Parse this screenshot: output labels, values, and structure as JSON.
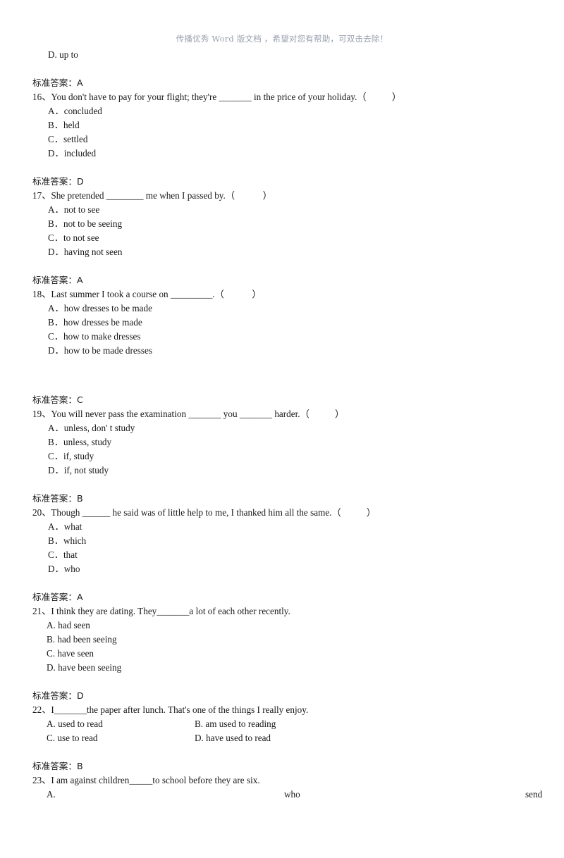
{
  "page": {
    "watermark": "传播优秀 Word 版文档 ，希望对您有帮助，可双击去除！",
    "accent_color": "#9aa0ae",
    "text_color": "#181818",
    "background": "#ffffff"
  },
  "orphan_option": {
    "label": "D. up to"
  },
  "items": [
    {
      "answer_label": "标准答案：A",
      "number": "16、",
      "stem": "16、You don't have to pay for your flight; they're _______ in the price of your holiday.（           ）",
      "options": [
        "A．concluded",
        "B．held",
        "C．settled",
        "D．included"
      ]
    },
    {
      "answer_label": "标准答案：D",
      "number": "17、",
      "stem": "17、She pretended ________ me when I passed by.（            ）",
      "options": [
        "A．not to see",
        "B．not to be seeing",
        "C．to not see",
        "D．having not seen"
      ]
    },
    {
      "answer_label": "标准答案：A",
      "number": "18、",
      "stem": "18、Last summer I took a course on _________.（            ）",
      "options": [
        "A．how dresses to be made",
        "B．how dresses be made",
        "C．how to make dresses",
        "D．how to be made dresses"
      ]
    },
    {
      "answer_label": "标准答案：C",
      "number": "19、",
      "stem": "19、You will never pass the examination _______ you _______ harder.（           ）",
      "options": [
        "A．unless, don' t study",
        "B．unless, study",
        "C．if, study",
        "D．if, not study"
      ]
    },
    {
      "answer_label": "标准答案：B",
      "number": "20、",
      "stem": "20、Though ______ he said was of little help to me, I thanked him all the same.（           ）",
      "options": [
        "A．what",
        "B．which",
        "C．that",
        "D．who"
      ]
    },
    {
      "answer_label": "标准答案：A",
      "number": "21、",
      "stem": "21、I think they are dating. They_______a lot of each other recently.",
      "options": [
        "A. had seen",
        "B. had been seeing",
        "C. have seen",
        "D. have been seeing"
      ]
    },
    {
      "answer_label": "标准答案：D",
      "number": "22、",
      "stem": "22、I_______the paper after lunch. That's one of the things I really enjoy.",
      "options_grid": [
        {
          "left": "A. used to read",
          "right": "B. am used to reading"
        },
        {
          "left": "C. use to read",
          "right": "D. have used to read"
        }
      ]
    },
    {
      "answer_label": "标准答案：B",
      "number": "23、",
      "stem": "23、I am against children_____to school before they are six.",
      "spread_option": {
        "part1": "A.",
        "part2": "who",
        "part3": "send"
      }
    }
  ]
}
